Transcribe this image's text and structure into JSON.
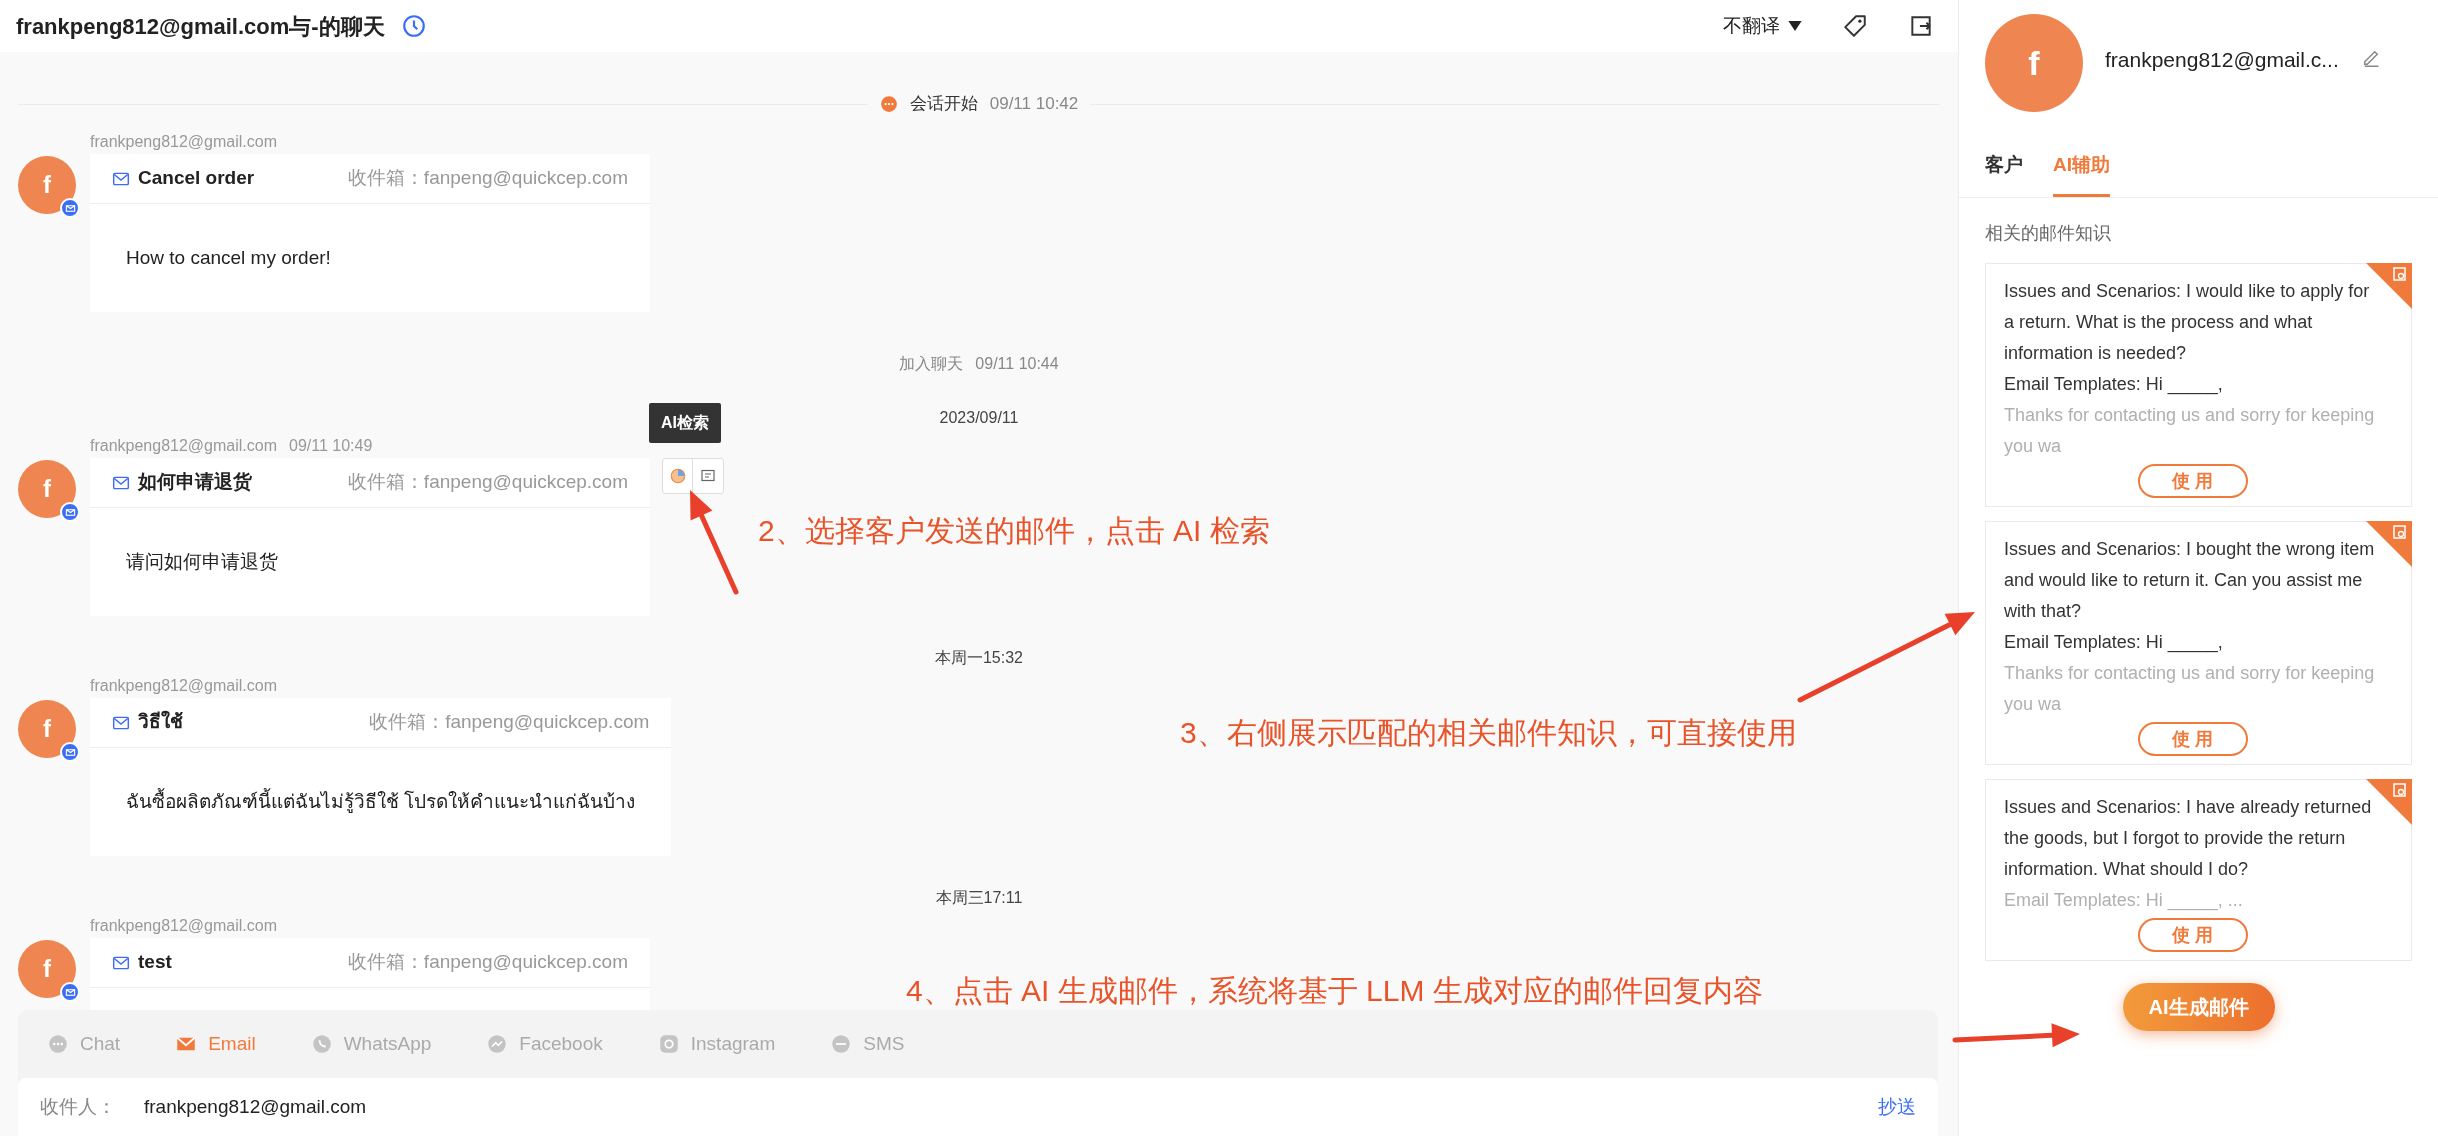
{
  "header": {
    "title": "frankpeng812@gmail.com与-的聊天",
    "translate": "不翻译"
  },
  "timeline": [
    {
      "kind": "event",
      "label": "会话开始",
      "time": "09/11 10:42"
    },
    {
      "kind": "message",
      "sender": "frankpeng812@gmail.com",
      "avatar": "f",
      "subject": "Cancel order",
      "inbox_label": "收件箱：",
      "inbox": "fanpeng@quickcep.com",
      "body": "How to cancel my order!"
    },
    {
      "kind": "notice",
      "label": "加入聊天",
      "time": "09/11 10:44"
    },
    {
      "kind": "date",
      "label": "2023/09/11"
    },
    {
      "kind": "message",
      "sender": "frankpeng812@gmail.com",
      "time": "09/11 10:49",
      "avatar": "f",
      "subject": "如何申请退货",
      "inbox_label": "收件箱：",
      "inbox": "fanpeng@quickcep.com",
      "body": "请问如何申请退货",
      "tooltip": "AI检索"
    },
    {
      "kind": "date",
      "label": "本周一15:32"
    },
    {
      "kind": "message",
      "sender": "frankpeng812@gmail.com",
      "avatar": "f",
      "subject": "วิธีใช้",
      "inbox_label": "收件箱：",
      "inbox": "fanpeng@quickcep.com",
      "body": "ฉันซื้อผลิตภัณฑ์นี้แต่ฉันไม่รู้วิธีใช้ โปรดให้คำแนะนำแก่ฉันบ้าง"
    },
    {
      "kind": "date",
      "label": "本周三17:11"
    },
    {
      "kind": "message",
      "sender": "frankpeng812@gmail.com",
      "avatar": "f",
      "subject": "test",
      "inbox_label": "收件箱：",
      "inbox": "fanpeng@quickcep.com"
    }
  ],
  "composer": {
    "channels": [
      {
        "label": "Chat",
        "selected": false
      },
      {
        "label": "Email",
        "selected": true
      },
      {
        "label": "WhatsApp",
        "selected": false
      },
      {
        "label": "Facebook",
        "selected": false
      },
      {
        "label": "Instagram",
        "selected": false
      },
      {
        "label": "SMS",
        "selected": false
      }
    ],
    "recipient_label": "收件人：",
    "recipient": "frankpeng812@gmail.com",
    "cc": "抄送"
  },
  "sidebar": {
    "avatar": "f",
    "name": "frankpeng812@gmail.c...",
    "tabs": [
      {
        "label": "客户",
        "selected": false
      },
      {
        "label": "AI辅助",
        "selected": true
      }
    ],
    "section_title": "相关的邮件知识",
    "cards": [
      {
        "question": "Issues and Scenarios: I would like to apply for a return. What is the process and what information is needed?",
        "template": "Email Templates: Hi _____,",
        "preview": "Thanks for contacting us and sorry for keeping you wa",
        "button": "使 用"
      },
      {
        "question": "Issues and Scenarios: I bought the wrong item and would like to return it. Can you assist me with that?",
        "template": "Email Templates: Hi _____,",
        "preview": "Thanks for contacting us and sorry for keeping you wa",
        "button": "使 用"
      },
      {
        "question": "Issues and Scenarios: I have already returned the goods, but I forgot to provide the return information. What should I do?",
        "preview": "Email Templates: Hi _____, ...",
        "button": "使 用"
      }
    ],
    "generate_button": "AI生成邮件"
  },
  "annotations": [
    "2、选择客户发送的邮件，点击 AI 检索",
    "3、右侧展示匹配的相关邮件知识，可直接使用",
    "4、点击 AI 生成邮件，系统将基于 LLM 生成对应的邮件回复内容"
  ]
}
